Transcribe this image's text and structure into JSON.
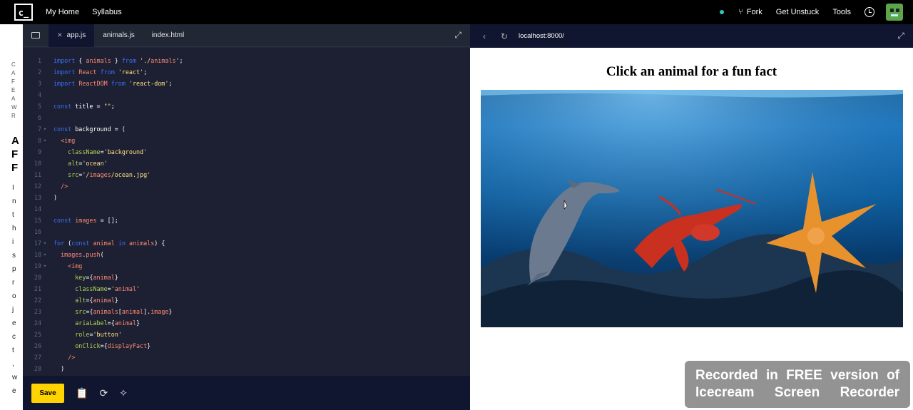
{
  "topbar": {
    "logo_text": "c_",
    "nav": [
      "My Home",
      "Syllabus"
    ],
    "fork_label": "Fork",
    "get_unstuck_label": "Get Unstuck",
    "tools_label": "Tools"
  },
  "lesson_panel": {
    "small_letters": [
      "C",
      "A",
      "F",
      "E",
      "A",
      "W",
      "R"
    ],
    "big_letters": [
      "A",
      "F",
      "F"
    ],
    "body_letters": [
      "I",
      "n",
      "t",
      "h",
      "i",
      "s",
      "p",
      "r",
      "o",
      "j",
      "e",
      "c",
      "t",
      ",",
      "w",
      "e"
    ]
  },
  "editor": {
    "tabs": [
      {
        "label": "app.js",
        "active": true
      },
      {
        "label": "animals.js",
        "active": false
      },
      {
        "label": "index.html",
        "active": false
      }
    ],
    "lines": [
      {
        "n": "1",
        "text": "import { animals } from './animals';"
      },
      {
        "n": "2",
        "text": "import React from 'react';"
      },
      {
        "n": "3",
        "text": "import ReactDOM from 'react-dom';"
      },
      {
        "n": "4",
        "text": ""
      },
      {
        "n": "5",
        "text": "const title = \"\";"
      },
      {
        "n": "6",
        "text": ""
      },
      {
        "n": "7",
        "text": "const background = ("
      },
      {
        "n": "8",
        "text": "  <img"
      },
      {
        "n": "9",
        "text": "    className='background'"
      },
      {
        "n": "10",
        "text": "    alt='ocean'"
      },
      {
        "n": "11",
        "text": "    src='/images/ocean.jpg'"
      },
      {
        "n": "12",
        "text": "  />"
      },
      {
        "n": "13",
        "text": ")"
      },
      {
        "n": "14",
        "text": ""
      },
      {
        "n": "15",
        "text": "const images = [];"
      },
      {
        "n": "16",
        "text": ""
      },
      {
        "n": "17",
        "text": "for (const animal in animals) {"
      },
      {
        "n": "18",
        "text": "  images.push("
      },
      {
        "n": "19",
        "text": "    <img"
      },
      {
        "n": "20",
        "text": "      key={animal}"
      },
      {
        "n": "21",
        "text": "      className='animal'"
      },
      {
        "n": "22",
        "text": "      alt={animal}"
      },
      {
        "n": "23",
        "text": "      src={animals[animal].image}"
      },
      {
        "n": "24",
        "text": "      ariaLabel={animal}"
      },
      {
        "n": "25",
        "text": "      role='button'"
      },
      {
        "n": "26",
        "text": "      onClick={displayFact}"
      },
      {
        "n": "27",
        "text": "    />"
      },
      {
        "n": "28",
        "text": "  )"
      }
    ],
    "fold_lines": [
      "7",
      "8",
      "17",
      "18",
      "19"
    ],
    "save_label": "Save"
  },
  "browser": {
    "url": "localhost:8000/",
    "heading": "Click an animal for a fun fact"
  },
  "watermark": {
    "line1": "Recorded in FREE version of",
    "line2": "Icecream Screen Recorder"
  },
  "colors": {
    "accent_yellow": "#ffd300",
    "editor_bg": "#1c2032",
    "status_dot": "#37c3be"
  }
}
